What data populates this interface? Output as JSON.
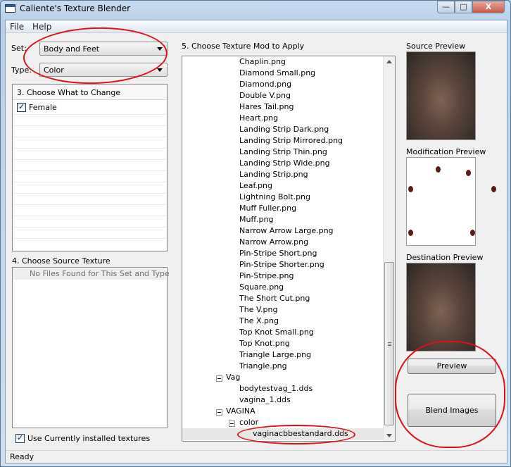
{
  "window": {
    "title": "Caliente's Texture Blender",
    "min_label": "—",
    "max_label": "□",
    "close_label": "X"
  },
  "menu": [
    "File",
    "Help"
  ],
  "set_field": {
    "label": "Set:",
    "value": "Body and Feet"
  },
  "type_field": {
    "label": "Type:",
    "value": "Color"
  },
  "section3": {
    "title": "3. Choose What to Change",
    "items": [
      {
        "label": "Female",
        "checked": true
      }
    ]
  },
  "section4": {
    "title": "4. Choose Source Texture",
    "empty_text": "No Files Found for This Set and Type"
  },
  "use_installed": {
    "label": "Use Currently installed textures",
    "checked": true
  },
  "section5": {
    "title": "5. Choose Texture Mod to Apply",
    "files": [
      "Chaplin.png",
      "Diamond Small.png",
      "Diamond.png",
      "Double V.png",
      "Hares Tail.png",
      "Heart.png",
      "Landing Strip Dark.png",
      "Landing Strip Mirrored.png",
      "Landing Strip Thin.png",
      "Landing Strip Wide.png",
      "Landing Strip.png",
      "Leaf.png",
      "Lightning Bolt.png",
      "Muff Fuller.png",
      "Muff.png",
      "Narrow Arrow Large.png",
      "Narrow Arrow.png",
      "Pin-Stripe Short.png",
      "Pin-Stripe Shorter.png",
      "Pin-Stripe.png",
      "Square.png",
      "The Short Cut.png",
      "The V.png",
      "The X.png",
      "Top Knot Small.png",
      "Top Knot.png",
      "Triangle Large.png",
      "Triangle.png"
    ],
    "vag_folder": "Vag",
    "vag_files": [
      "bodytestvag_1.dds",
      "vagina_1.dds"
    ],
    "vagina_folder": "VAGINA",
    "color_folder": "color",
    "selected_file": "vaginacbbestandard.dds"
  },
  "previews": {
    "source": "Source Preview",
    "modification": "Modification Preview",
    "destination": "Destination Preview"
  },
  "buttons": {
    "preview": "Preview",
    "blend": "Blend Images"
  },
  "status": "Ready",
  "colors": {
    "annotation": "#e0101a",
    "selection": "#e8e8e8"
  }
}
